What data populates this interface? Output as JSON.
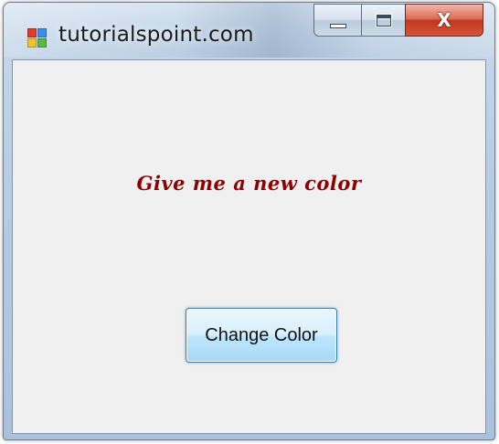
{
  "window": {
    "title": "tutorialspoint.com",
    "icon": "windows-form-icon",
    "caption_buttons": {
      "minimize_icon": "minimize-icon",
      "maximize_icon": "maximize-icon",
      "close_label": "X"
    }
  },
  "form": {
    "message": "Give me a new color",
    "message_color": "#8b0000",
    "button_label": "Change Color"
  },
  "colors": {
    "client_background": "#f0f0f0",
    "close_button": "#c2371f",
    "button_border": "#3c7fb1"
  }
}
